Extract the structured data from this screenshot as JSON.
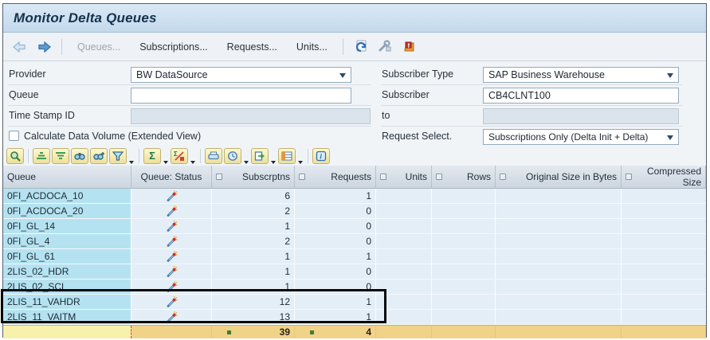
{
  "window": {
    "title": "Monitor Delta Queues"
  },
  "app_toolbar": {
    "back_icon": "back-arrow",
    "forward_icon": "forward-arrow",
    "buttons": {
      "queues": "Queues...",
      "subscriptions": "Subscriptions...",
      "requests": "Requests...",
      "units": "Units..."
    },
    "icons": [
      "refresh-icon",
      "services-icon",
      "alerts-icon"
    ]
  },
  "form": {
    "provider_label": "Provider",
    "provider_value": "BW DataSource",
    "queue_label": "Queue",
    "queue_value": "",
    "timestamp_label": "Time Stamp ID",
    "timestamp_value": "",
    "calc_checkbox_label": "Calculate Data Volume (Extended View)",
    "calc_checkbox_checked": false,
    "subscriber_type_label": "Subscriber Type",
    "subscriber_type_value": "SAP Business Warehouse",
    "subscriber_label": "Subscriber",
    "subscriber_value": "CB4CLNT100",
    "to_label": "to",
    "to_value": "",
    "request_select_label": "Request Select.",
    "request_select_value": "Subscriptions Only (Delta Init + Delta)"
  },
  "alv_toolbar": {
    "icons": [
      "details-icon",
      "sort-ascending-icon",
      "sort-descending-icon",
      "find-icon",
      "find-next-icon",
      "filter-icon",
      "total-icon",
      "subtotal-icon",
      "print-icon",
      "views-icon",
      "export-icon",
      "layout-icon",
      "info-icon"
    ]
  },
  "grid": {
    "columns": [
      "Queue",
      "Queue: Status",
      "Subscrptns",
      "Requests",
      "Units",
      "Rows",
      "Original Size in Bytes",
      "Compressed Size"
    ],
    "status_icon": "delta-wand-icon",
    "rows": [
      {
        "queue": "0FI_ACDOCA_10",
        "subscrptns": "6",
        "requests": "1",
        "units": "",
        "rows": "",
        "original_size": "",
        "compressed_size": ""
      },
      {
        "queue": "0FI_ACDOCA_20",
        "subscrptns": "2",
        "requests": "0",
        "units": "",
        "rows": "",
        "original_size": "",
        "compressed_size": ""
      },
      {
        "queue": "0FI_GL_14",
        "subscrptns": "1",
        "requests": "0",
        "units": "",
        "rows": "",
        "original_size": "",
        "compressed_size": ""
      },
      {
        "queue": "0FI_GL_4",
        "subscrptns": "2",
        "requests": "0",
        "units": "",
        "rows": "",
        "original_size": "",
        "compressed_size": ""
      },
      {
        "queue": "0FI_GL_61",
        "subscrptns": "1",
        "requests": "1",
        "units": "",
        "rows": "",
        "original_size": "",
        "compressed_size": ""
      },
      {
        "queue": "2LIS_02_HDR",
        "subscrptns": "1",
        "requests": "0",
        "units": "",
        "rows": "",
        "original_size": "",
        "compressed_size": ""
      },
      {
        "queue": "2LIS_02_SCL",
        "subscrptns": "1",
        "requests": "0",
        "units": "",
        "rows": "",
        "original_size": "",
        "compressed_size": ""
      },
      {
        "queue": "2LIS_11_VAHDR",
        "subscrptns": "12",
        "requests": "1",
        "units": "",
        "rows": "",
        "original_size": "",
        "compressed_size": ""
      },
      {
        "queue": "2LIS_11_VAITM",
        "subscrptns": "13",
        "requests": "1",
        "units": "",
        "rows": "",
        "original_size": "",
        "compressed_size": ""
      }
    ],
    "totals": {
      "subscrptns": "39",
      "requests": "4"
    },
    "highlighted_rows": [
      "2LIS_11_VAHDR",
      "2LIS_11_VAITM"
    ]
  },
  "colors": {
    "queue_cell": "#b5e2f0",
    "data_cell": "#e4eef7",
    "totals_queue_cell": "#f8f1ab",
    "totals_cell": "#f1d387",
    "sum_marker_green": "#3e7d3a",
    "highlight_border": "#0a0a0a",
    "titlebar_top": "#d9e9f5",
    "accent_blue": "#5b9bd3"
  }
}
